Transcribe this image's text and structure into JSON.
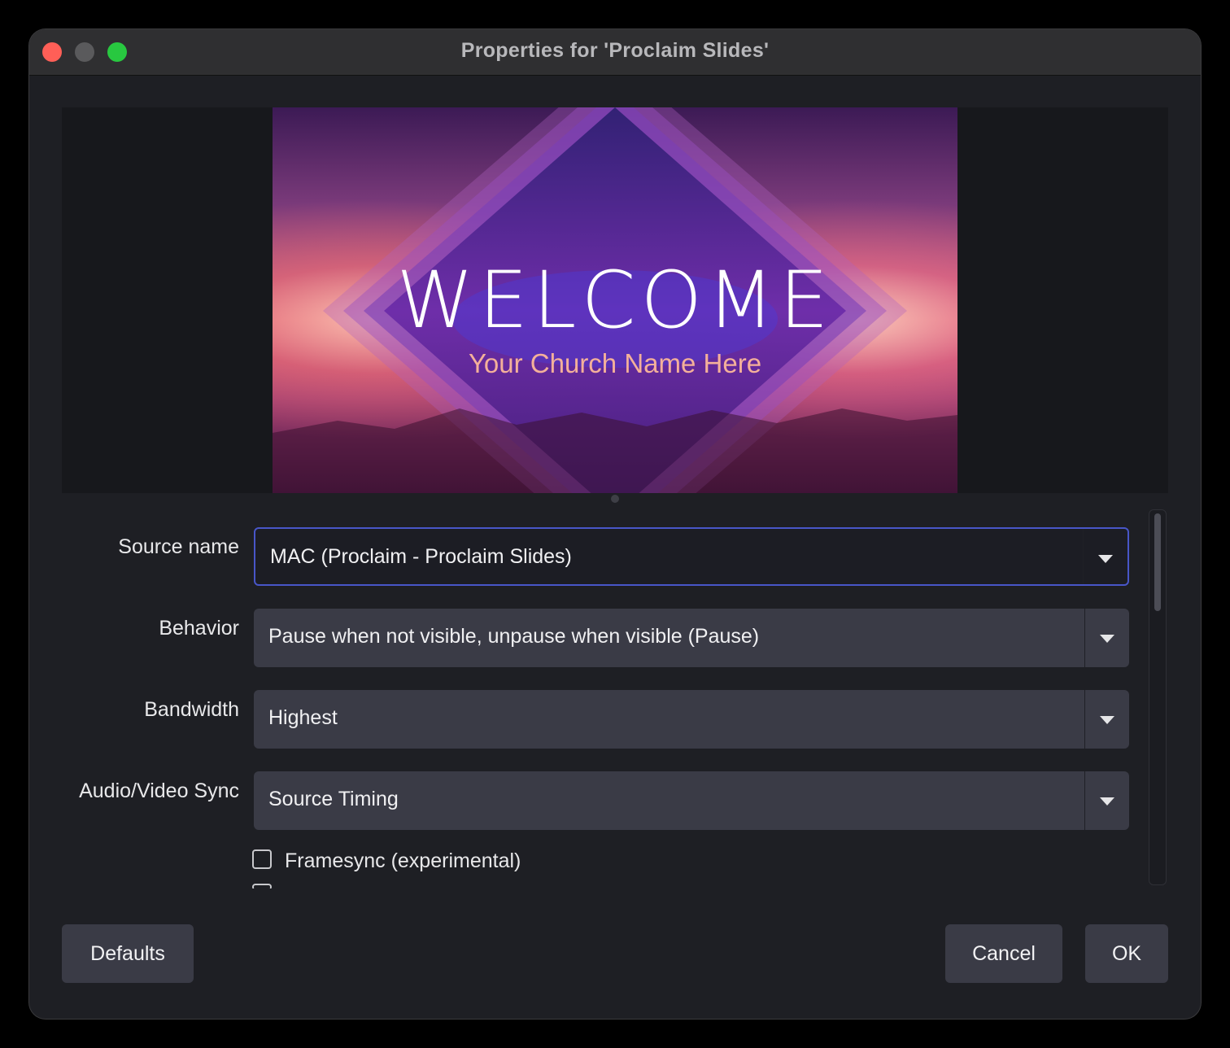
{
  "window": {
    "title": "Properties for 'Proclaim Slides'"
  },
  "preview": {
    "slide_title": "WELCOME",
    "slide_subtitle": "Your Church Name Here"
  },
  "form": {
    "source_name": {
      "label": "Source name",
      "value": "MAC (Proclaim - Proclaim Slides)"
    },
    "behavior": {
      "label": "Behavior",
      "value": "Pause when not visible, unpause when visible (Pause)"
    },
    "bandwidth": {
      "label": "Bandwidth",
      "value": "Highest"
    },
    "av_sync": {
      "label": "Audio/Video Sync",
      "value": "Source Timing"
    },
    "framesync": {
      "label": "Framesync (experimental)",
      "checked": false
    }
  },
  "buttons": {
    "defaults": "Defaults",
    "cancel": "Cancel",
    "ok": "OK"
  },
  "colors": {
    "close": "#ff5f57",
    "minimize": "#5a5a5c",
    "maximize": "#28c840",
    "focus_border": "#4856c8",
    "combo_bg": "#3a3b46",
    "window_bg": "#1e1f24"
  },
  "icons": [
    "close-icon",
    "minimize-icon",
    "maximize-icon",
    "chevron-down-icon",
    "checkbox-icon"
  ]
}
